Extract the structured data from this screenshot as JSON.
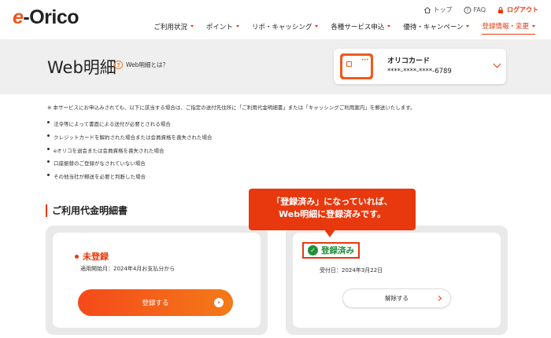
{
  "header": {
    "logo_e": "e",
    "logo_rest": "-Orico",
    "util": {
      "top": "トップ",
      "faq": "FAQ",
      "logout": "ログアウト"
    },
    "nav": [
      {
        "label": "ご利用状況",
        "active": false
      },
      {
        "label": "ポイント",
        "active": false
      },
      {
        "label": "リボ・キャッシング",
        "active": false
      },
      {
        "label": "各種サービス申込",
        "active": false
      },
      {
        "label": "優待・キャンペーン",
        "active": false
      },
      {
        "label": "登録情報・変更",
        "active": true
      }
    ]
  },
  "title_band": {
    "page_title": "Web明細",
    "help_icon": "?",
    "help_label": "Web明細とは？",
    "card": {
      "name": "オリコカード",
      "number": "****-****-****-6789",
      "dots": "•••"
    }
  },
  "notice": {
    "lead": "※ 本サービスにお申込みされても、以下に該当する場合は、ご指定の送付先住所に「ご利用代金明細書」または「キャッシングご利用案内」を郵送いたします。",
    "items": [
      "法令等によって書面による送付が必要とされる場合",
      "クレジットカードを解約された場合または会員資格を喪失された場合",
      "eオリコを退会または会員資格を喪失された場合",
      "口座振替のご登録がなされていない場合",
      "その他当社が郵送を必要と判断した場合"
    ]
  },
  "section": {
    "heading": "ご利用代金明細書"
  },
  "panel_unregistered": {
    "status": "未登録",
    "start_date": "適用開始月：2024年4月お支払分から",
    "button": "登録する",
    "arrow": "›"
  },
  "panel_registered": {
    "check": "✓",
    "status": "登録済み",
    "accepted": "受付日：2024年3月22日",
    "button": "解除する"
  },
  "callout": {
    "line1": "「登録済み」になっていれば、",
    "line2": "Web明細に登録済みです。"
  },
  "colors": {
    "accent": "#e8380d",
    "success": "#1f8f3a",
    "band": "#efefef"
  }
}
